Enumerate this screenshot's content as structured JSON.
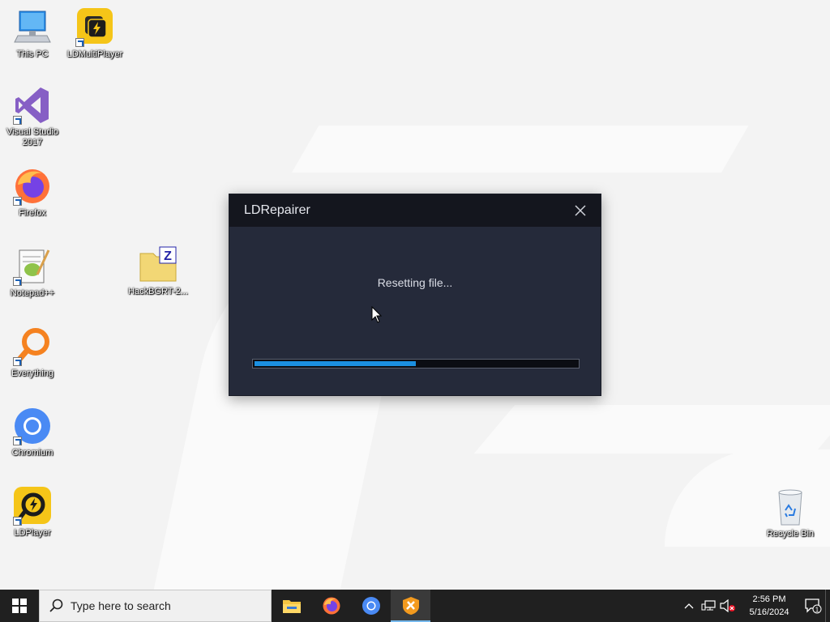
{
  "desktop": {
    "icons": [
      {
        "label": "This PC"
      },
      {
        "label": "LDMultiPlayer"
      },
      {
        "label": "Visual Studio 2017"
      },
      {
        "label": "Firefox"
      },
      {
        "label": "Notepad++"
      },
      {
        "label": "HackBGRT-2..."
      },
      {
        "label": "Everything"
      },
      {
        "label": "Chromium"
      },
      {
        "label": "LDPlayer"
      },
      {
        "label": "Recycle Bin"
      }
    ]
  },
  "dialog": {
    "title": "LDRepairer",
    "status": "Resetting file...",
    "progress_percent": 50,
    "progress_color": "#1b8fe0"
  },
  "taskbar": {
    "search_placeholder": "Type here to search",
    "apps": [
      "file-explorer-icon",
      "firefox-icon",
      "chromium-icon",
      "ldrepairer-icon"
    ],
    "clock_time": "2:56 PM",
    "clock_date": "5/16/2024",
    "notification_count": "1"
  }
}
